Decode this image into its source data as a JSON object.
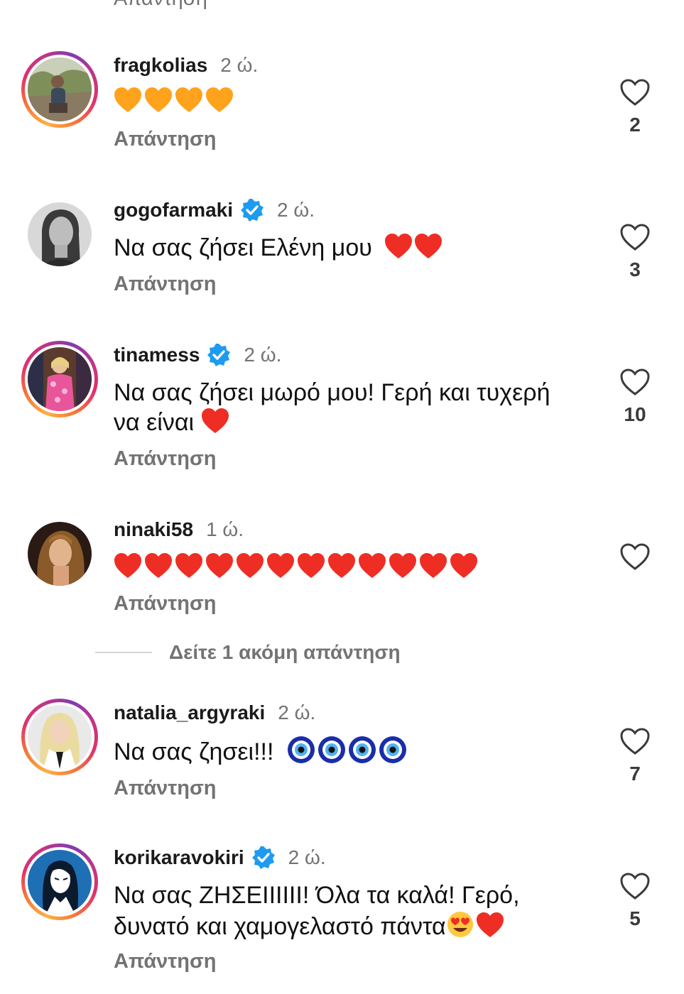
{
  "reply_label": "Απάντηση",
  "cut_top_label": "Απάντηση",
  "more_replies": "Δείτε 1 ακόμη απάντηση",
  "colors": {
    "text": "#111111",
    "muted": "#737373",
    "verified": "#1d9bf0",
    "heart_red": "#ee2e24",
    "heart_orange": "#ffa21c"
  },
  "comments": [
    {
      "username": "fragkolias",
      "time": "2 ώ.",
      "verified": false,
      "story_ring": true,
      "text": "",
      "emoji": [
        "orange-heart",
        "orange-heart",
        "orange-heart",
        "orange-heart"
      ],
      "likes": "2"
    },
    {
      "username": "gogofarmaki",
      "time": "2 ώ.",
      "verified": true,
      "story_ring": false,
      "text": "Να σας ζήσει Ελένη μου",
      "emoji": [
        "red-heart",
        "red-heart"
      ],
      "likes": "3"
    },
    {
      "username": "tinamess",
      "time": "2 ώ.",
      "verified": true,
      "story_ring": true,
      "text_line1": "Να σας ζήσει μωρό μου! Γερή και τυχερή",
      "text_line2": "να είναι",
      "emoji": [
        "red-heart"
      ],
      "likes": "10"
    },
    {
      "username": "ninaki58",
      "time": "1 ώ.",
      "verified": false,
      "story_ring": false,
      "text": "",
      "emoji": [
        "red-heart",
        "red-heart",
        "red-heart",
        "red-heart",
        "red-heart",
        "red-heart",
        "red-heart",
        "red-heart",
        "red-heart",
        "red-heart",
        "red-heart",
        "red-heart"
      ],
      "likes": ""
    },
    {
      "username": "natalia_argyraki",
      "time": "2 ώ.",
      "verified": false,
      "story_ring": true,
      "text": "Να σας ζησει!!!",
      "emoji": [
        "nazar-amulet",
        "nazar-amulet",
        "nazar-amulet",
        "nazar-amulet"
      ],
      "likes": "7"
    },
    {
      "username": "korikaravokiri",
      "time": "2 ώ.",
      "verified": true,
      "story_ring": true,
      "text_line1": "Να σας ΖΗΣΕΙΙΙΙΙΙ! Όλα τα καλά! Γερό,",
      "text_line2": "δυνατό και χαμογελαστό πάντα",
      "emoji": [
        "heart-eyes-face",
        "red-heart"
      ],
      "likes": "5"
    }
  ]
}
